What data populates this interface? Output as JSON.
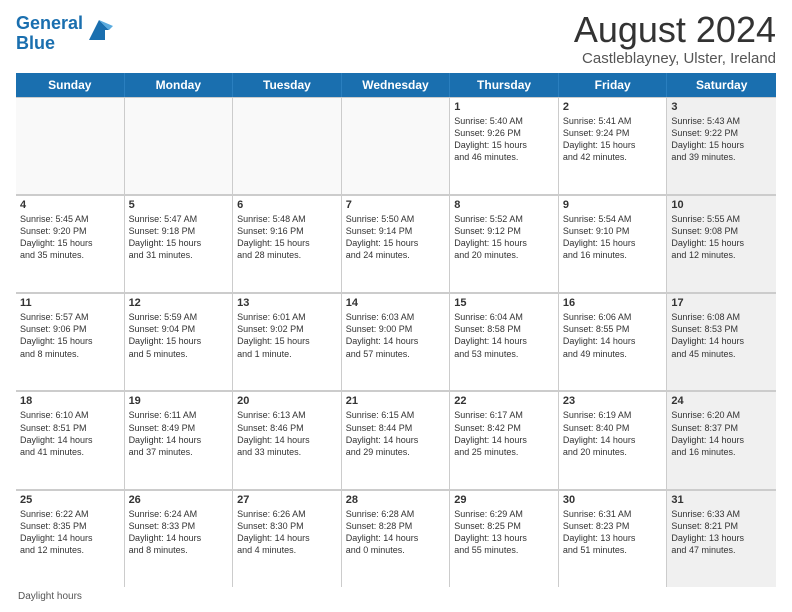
{
  "header": {
    "logo_line1": "General",
    "logo_line2": "Blue",
    "month_title": "August 2024",
    "location": "Castleblayney, Ulster, Ireland"
  },
  "days_of_week": [
    "Sunday",
    "Monday",
    "Tuesday",
    "Wednesday",
    "Thursday",
    "Friday",
    "Saturday"
  ],
  "footer": {
    "label": "Daylight hours"
  },
  "weeks": [
    [
      {
        "num": "",
        "info": ""
      },
      {
        "num": "",
        "info": ""
      },
      {
        "num": "",
        "info": ""
      },
      {
        "num": "",
        "info": ""
      },
      {
        "num": "1",
        "info": "Sunrise: 5:40 AM\nSunset: 9:26 PM\nDaylight: 15 hours\nand 46 minutes."
      },
      {
        "num": "2",
        "info": "Sunrise: 5:41 AM\nSunset: 9:24 PM\nDaylight: 15 hours\nand 42 minutes."
      },
      {
        "num": "3",
        "info": "Sunrise: 5:43 AM\nSunset: 9:22 PM\nDaylight: 15 hours\nand 39 minutes."
      }
    ],
    [
      {
        "num": "4",
        "info": "Sunrise: 5:45 AM\nSunset: 9:20 PM\nDaylight: 15 hours\nand 35 minutes."
      },
      {
        "num": "5",
        "info": "Sunrise: 5:47 AM\nSunset: 9:18 PM\nDaylight: 15 hours\nand 31 minutes."
      },
      {
        "num": "6",
        "info": "Sunrise: 5:48 AM\nSunset: 9:16 PM\nDaylight: 15 hours\nand 28 minutes."
      },
      {
        "num": "7",
        "info": "Sunrise: 5:50 AM\nSunset: 9:14 PM\nDaylight: 15 hours\nand 24 minutes."
      },
      {
        "num": "8",
        "info": "Sunrise: 5:52 AM\nSunset: 9:12 PM\nDaylight: 15 hours\nand 20 minutes."
      },
      {
        "num": "9",
        "info": "Sunrise: 5:54 AM\nSunset: 9:10 PM\nDaylight: 15 hours\nand 16 minutes."
      },
      {
        "num": "10",
        "info": "Sunrise: 5:55 AM\nSunset: 9:08 PM\nDaylight: 15 hours\nand 12 minutes."
      }
    ],
    [
      {
        "num": "11",
        "info": "Sunrise: 5:57 AM\nSunset: 9:06 PM\nDaylight: 15 hours\nand 8 minutes."
      },
      {
        "num": "12",
        "info": "Sunrise: 5:59 AM\nSunset: 9:04 PM\nDaylight: 15 hours\nand 5 minutes."
      },
      {
        "num": "13",
        "info": "Sunrise: 6:01 AM\nSunset: 9:02 PM\nDaylight: 15 hours\nand 1 minute."
      },
      {
        "num": "14",
        "info": "Sunrise: 6:03 AM\nSunset: 9:00 PM\nDaylight: 14 hours\nand 57 minutes."
      },
      {
        "num": "15",
        "info": "Sunrise: 6:04 AM\nSunset: 8:58 PM\nDaylight: 14 hours\nand 53 minutes."
      },
      {
        "num": "16",
        "info": "Sunrise: 6:06 AM\nSunset: 8:55 PM\nDaylight: 14 hours\nand 49 minutes."
      },
      {
        "num": "17",
        "info": "Sunrise: 6:08 AM\nSunset: 8:53 PM\nDaylight: 14 hours\nand 45 minutes."
      }
    ],
    [
      {
        "num": "18",
        "info": "Sunrise: 6:10 AM\nSunset: 8:51 PM\nDaylight: 14 hours\nand 41 minutes."
      },
      {
        "num": "19",
        "info": "Sunrise: 6:11 AM\nSunset: 8:49 PM\nDaylight: 14 hours\nand 37 minutes."
      },
      {
        "num": "20",
        "info": "Sunrise: 6:13 AM\nSunset: 8:46 PM\nDaylight: 14 hours\nand 33 minutes."
      },
      {
        "num": "21",
        "info": "Sunrise: 6:15 AM\nSunset: 8:44 PM\nDaylight: 14 hours\nand 29 minutes."
      },
      {
        "num": "22",
        "info": "Sunrise: 6:17 AM\nSunset: 8:42 PM\nDaylight: 14 hours\nand 25 minutes."
      },
      {
        "num": "23",
        "info": "Sunrise: 6:19 AM\nSunset: 8:40 PM\nDaylight: 14 hours\nand 20 minutes."
      },
      {
        "num": "24",
        "info": "Sunrise: 6:20 AM\nSunset: 8:37 PM\nDaylight: 14 hours\nand 16 minutes."
      }
    ],
    [
      {
        "num": "25",
        "info": "Sunrise: 6:22 AM\nSunset: 8:35 PM\nDaylight: 14 hours\nand 12 minutes."
      },
      {
        "num": "26",
        "info": "Sunrise: 6:24 AM\nSunset: 8:33 PM\nDaylight: 14 hours\nand 8 minutes."
      },
      {
        "num": "27",
        "info": "Sunrise: 6:26 AM\nSunset: 8:30 PM\nDaylight: 14 hours\nand 4 minutes."
      },
      {
        "num": "28",
        "info": "Sunrise: 6:28 AM\nSunset: 8:28 PM\nDaylight: 14 hours\nand 0 minutes."
      },
      {
        "num": "29",
        "info": "Sunrise: 6:29 AM\nSunset: 8:25 PM\nDaylight: 13 hours\nand 55 minutes."
      },
      {
        "num": "30",
        "info": "Sunrise: 6:31 AM\nSunset: 8:23 PM\nDaylight: 13 hours\nand 51 minutes."
      },
      {
        "num": "31",
        "info": "Sunrise: 6:33 AM\nSunset: 8:21 PM\nDaylight: 13 hours\nand 47 minutes."
      }
    ]
  ]
}
